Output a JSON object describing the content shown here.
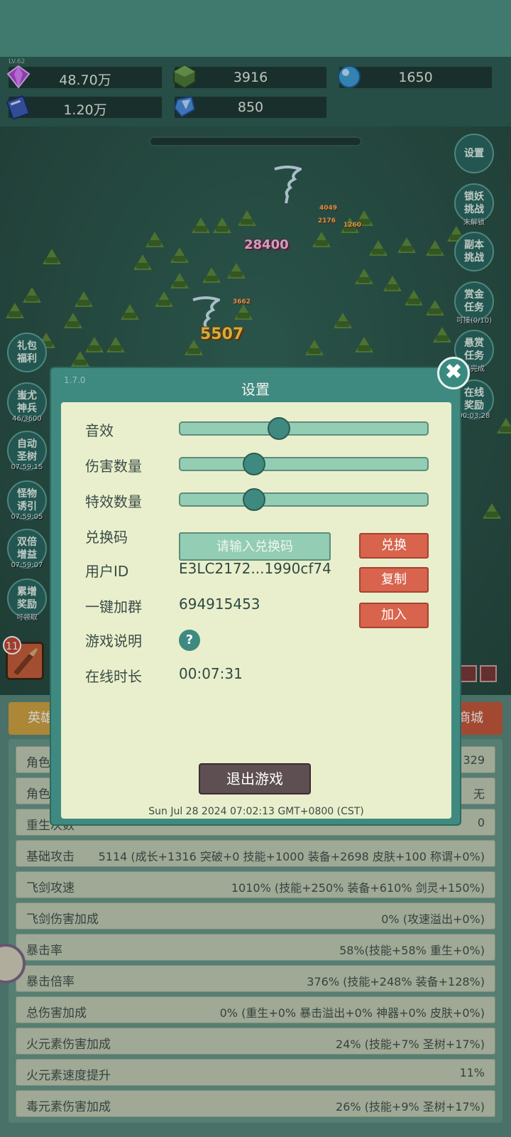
{
  "resources": {
    "level_tag": "LV.62",
    "gems": "48.70万",
    "ore": "3916",
    "orb": "1650",
    "book": "1.20万",
    "crystal": "850"
  },
  "battle": {
    "dmg_main": "28400",
    "dmg_crit": "5507",
    "dmg_small1": "4049",
    "dmg_small2": "3662",
    "dmg_small3": "2176",
    "dmg_small4": "1260"
  },
  "side_right": [
    {
      "label": "设置",
      "cap": ""
    },
    {
      "label": "锁妖\n挑战",
      "cap": "未解锁"
    },
    {
      "label": "副本\n挑战",
      "cap": ""
    },
    {
      "label": "赏金\n任务",
      "cap": "可接(0/10)"
    },
    {
      "label": "悬赏\n任务",
      "cap": "已完成"
    },
    {
      "label": "在线\n奖励",
      "cap": "00:03:28"
    }
  ],
  "side_left": [
    {
      "label": "礼包\n福利",
      "cap": ""
    },
    {
      "label": "蚩尤\n神兵",
      "cap": "46/3600"
    },
    {
      "label": "自动\n圣树",
      "cap": "07:59:15"
    },
    {
      "label": "怪物\n诱引",
      "cap": "07:59:05"
    },
    {
      "label": "双倍\n增益",
      "cap": "07:59:07"
    },
    {
      "label": "累增\n奖励",
      "cap": "可领取"
    }
  ],
  "skill_badge": "11",
  "tabs": {
    "left": "英雄",
    "right": "商城"
  },
  "stats": [
    {
      "k": "角色",
      "v": "329"
    },
    {
      "k": "角色",
      "v": "无"
    },
    {
      "k": "重生次数",
      "v": "0"
    },
    {
      "k": "基础攻击",
      "v": "5114 (成长+1316 突破+0 技能+1000 装备+2698 皮肤+100 称谓+0%)"
    },
    {
      "k": "飞剑攻速",
      "v": "1010% (技能+250% 装备+610% 剑灵+150%)"
    },
    {
      "k": "飞剑伤害加成",
      "v": "0% (攻速溢出+0%)"
    },
    {
      "k": "暴击率",
      "v": "58%(技能+58% 重生+0%)"
    },
    {
      "k": "暴击倍率",
      "v": "376% (技能+248% 装备+128%)"
    },
    {
      "k": "总伤害加成",
      "v": "0% (重生+0% 暴击溢出+0% 神器+0% 皮肤+0%)"
    },
    {
      "k": "火元素伤害加成",
      "v": "24% (技能+7% 圣树+17%)"
    },
    {
      "k": "火元素速度提升",
      "v": "11%"
    },
    {
      "k": "毒元素伤害加成",
      "v": "26% (技能+9% 圣树+17%)"
    }
  ],
  "dialog": {
    "title": "设置",
    "version": "1.7.0",
    "sound_label": "音效",
    "sound_level": 0.4,
    "damage_count_label": "伤害数量",
    "damage_count_level": 0.3,
    "effects_count_label": "特效数量",
    "effects_count_level": 0.3,
    "redeem_label": "兑换码",
    "redeem_placeholder": "请输入兑换码",
    "redeem_button": "兑换",
    "user_id_label": "用户ID",
    "user_id_value": "E3LC2172...1990cf74",
    "copy_button": "复制",
    "group_label": "一键加群",
    "group_value": "694915453",
    "join_button": "加入",
    "guide_label": "游戏说明",
    "guide_icon": "?",
    "online_label": "在线时长",
    "online_value": "00:07:31",
    "exit_button": "退出游戏",
    "datetime": "Sun Jul 28 2024 07:02:13 GMT+0800 (CST)",
    "close_glyph": "✖"
  },
  "colors": {
    "dialog_bg": "#e9efcc",
    "dialog_frame": "#3f8a80",
    "accent_red": "#d8644d",
    "slider_fill": "#93cdb3",
    "exit_btn": "#5e4f52"
  }
}
